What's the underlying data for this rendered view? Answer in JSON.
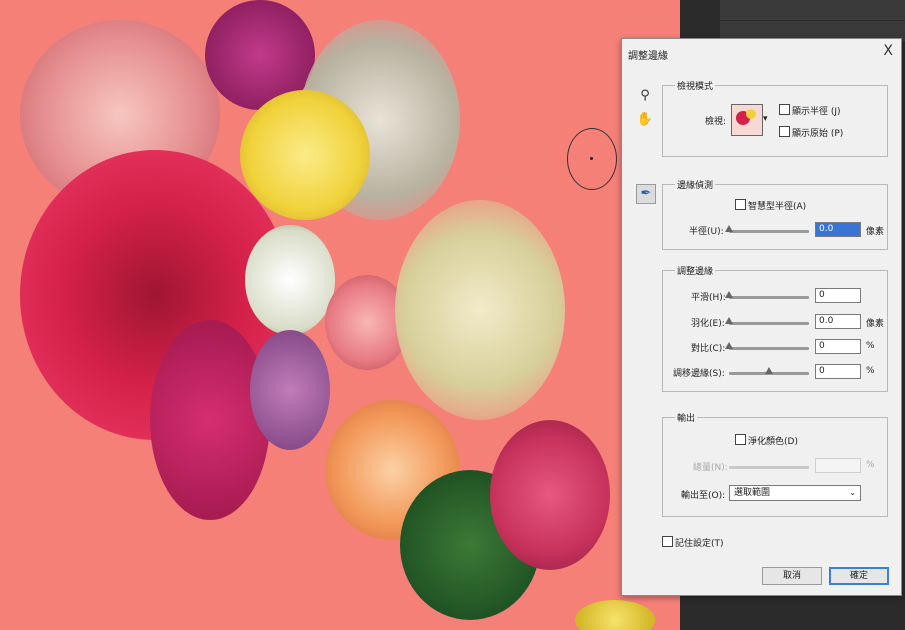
{
  "dialog": {
    "title": "調整邊緣",
    "close": "X",
    "view_mode": {
      "title": "檢視模式",
      "view_label": "檢視:",
      "show_radius": "顯示半徑 (J)",
      "show_original": "顯示原始 (P)"
    },
    "edge_detection": {
      "title": "邊緣偵測",
      "smart_radius": "智慧型半徑(A)",
      "radius_label": "半徑(U):",
      "radius_value": "0.0",
      "radius_unit": "像素"
    },
    "adjust_edge": {
      "title": "調整邊緣",
      "smooth_label": "平滑(H):",
      "smooth_value": "0",
      "feather_label": "羽化(E):",
      "feather_value": "0.0",
      "feather_unit": "像素",
      "contrast_label": "對比(C):",
      "contrast_value": "0",
      "contrast_unit": "%",
      "shift_label": "調移邊緣(S):",
      "shift_value": "0",
      "shift_unit": "%"
    },
    "output": {
      "title": "輸出",
      "decontaminate": "淨化顏色(D)",
      "amount_label": "總量(N):",
      "amount_unit": "%",
      "output_to_label": "輸出至(O):",
      "output_to_value": "選取範圍"
    },
    "remember": "記住設定(T)",
    "cancel": "取消",
    "ok": "確定"
  },
  "colors": {
    "canvas_bg": "#f58078",
    "accent": "#3875d7"
  }
}
